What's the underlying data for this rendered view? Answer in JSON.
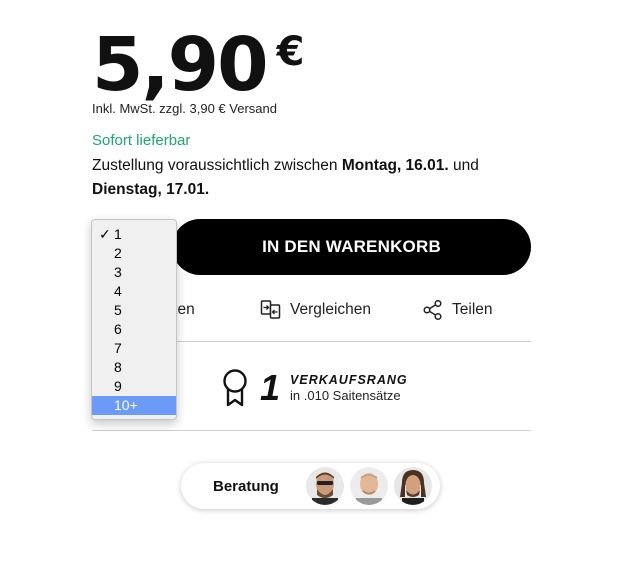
{
  "price": {
    "amount": "5,90",
    "currency": "€"
  },
  "tax_note": "Inkl. MwSt. zzgl. 3,90 € Versand",
  "stock_status": "Sofort lieferbar",
  "delivery": {
    "prefix": "Zustellung voraussichtlich zwischen ",
    "date_from": "Montag, 16.01.",
    "middle": " und",
    "date_to": "Dienstag, 17.01."
  },
  "cart_button": "IN DEN WARENKORB",
  "actions": {
    "remember_partial": "erken",
    "compare": "Vergleichen",
    "share": "Teilen"
  },
  "rank": {
    "number": "1",
    "label": "VERKAUFSRANG",
    "category": "in .010 Saitensätze"
  },
  "advice": {
    "label": "Beratung"
  },
  "quantity_dropdown": {
    "selected": "1",
    "highlighted": "10+",
    "options": [
      "1",
      "2",
      "3",
      "4",
      "5",
      "6",
      "7",
      "8",
      "9",
      "10+"
    ]
  },
  "colors": {
    "stock_green": "#1fa76c",
    "highlight_blue": "#6b9bf7",
    "button_black": "#000000"
  }
}
